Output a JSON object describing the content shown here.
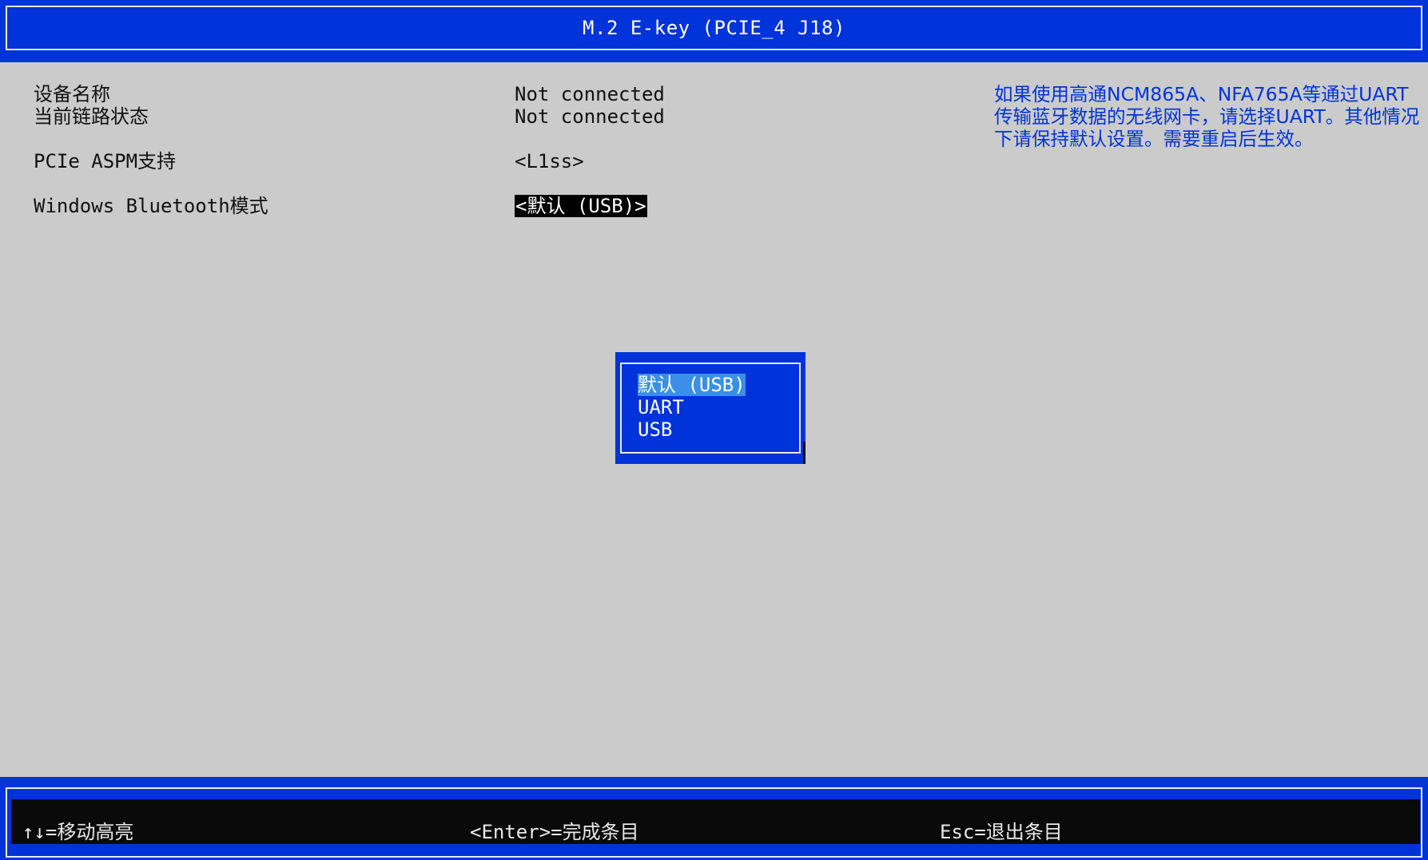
{
  "window": {
    "title": "M.2 E-key (PCIE_4 J18)"
  },
  "settings": [
    {
      "label": "设备名称",
      "value": "Not connected"
    },
    {
      "label": "当前链路状态",
      "value": "Not connected"
    },
    {
      "label": "PCIe ASPM支持",
      "value": "<L1ss>"
    },
    {
      "label": "Windows Bluetooth模式",
      "value": "<默认 (USB)>"
    }
  ],
  "help": {
    "text": "如果使用高通NCM865A、NFA765A等通过UART传输蓝牙数据的无线网卡，请选择UART。其他情况下请保持默认设置。需要重启后生效。"
  },
  "popup": {
    "options": [
      "默认 (USB)",
      "UART",
      "USB"
    ],
    "selected_index": 0
  },
  "footer": {
    "hints": [
      "↑↓=移动高亮",
      "<Enter>=完成条目",
      "Esc=退出条目"
    ]
  },
  "colors": {
    "background": "#cbcbcb",
    "accent_blue": "#0033d9",
    "highlight_black": "#000000",
    "popup_selection": "#3a8fe6"
  }
}
